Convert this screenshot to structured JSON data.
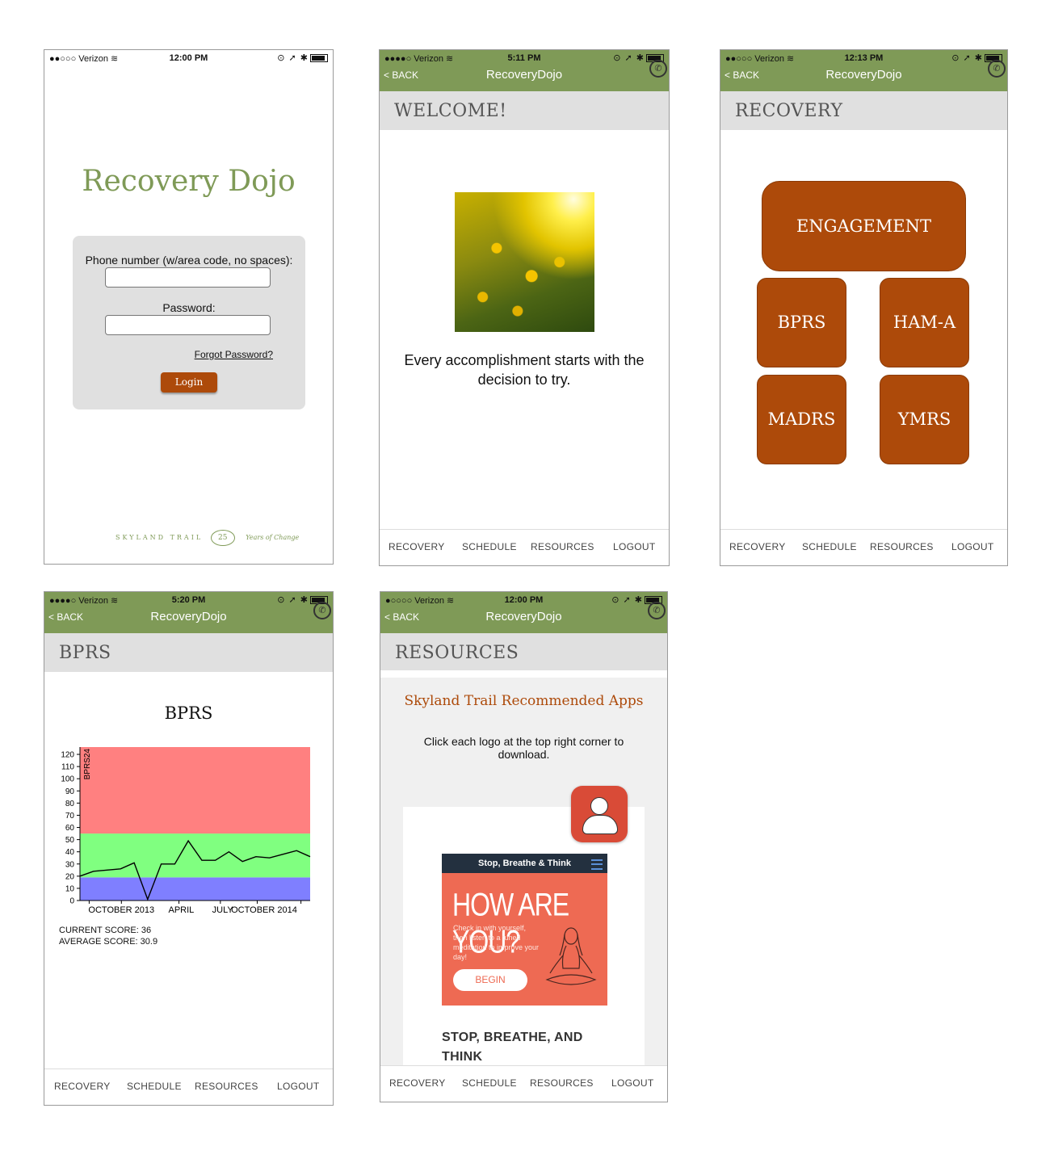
{
  "status": {
    "carrier": "Verizon",
    "times": [
      "12:00 PM",
      "5:11 PM",
      "12:13 PM",
      "5:20 PM",
      "12:00 PM"
    ]
  },
  "nav": {
    "back_label": "< BACK",
    "app_title": "RecoveryDojo"
  },
  "tabs": [
    "RECOVERY",
    "SCHEDULE",
    "RESOURCES",
    "LOGOUT"
  ],
  "login": {
    "title": "Recovery Dojo",
    "phone_label": "Phone number (w/area code, no spaces):",
    "password_label": "Password:",
    "forgot_label": "Forgot Password?",
    "login_label": "Login",
    "footer_brand": "SKYLAND TRAIL",
    "footer_tagline": "Years of Change",
    "footer_mark": "25"
  },
  "welcome": {
    "page_title": "WELCOME!",
    "quote": "Every accomplishment starts with the decision to try."
  },
  "recovery": {
    "page_title": "RECOVERY",
    "tiles": [
      "ENGAGEMENT",
      "BPRS",
      "HAM-A",
      "MADRS",
      "YMRS"
    ]
  },
  "bprs": {
    "page_title": "BPRS",
    "chart_title": "BPRS",
    "current_score": "CURRENT SCORE: 36",
    "average_score": "AVERAGE SCORE: 30.9"
  },
  "chart_data": {
    "type": "line",
    "title": "BPRS",
    "ylabel": "BPRS24",
    "xlabel": "",
    "ylim": [
      0,
      126
    ],
    "yticks": [
      0,
      10,
      20,
      30,
      40,
      50,
      60,
      70,
      80,
      90,
      100,
      110,
      120
    ],
    "xtick_labels": [
      "OCTOBER 2013",
      "APRIL",
      "JULY",
      "OCTOBER 2014"
    ],
    "bands": [
      {
        "from": 0,
        "to": 19,
        "color": "#7f7fff"
      },
      {
        "from": 19,
        "to": 55,
        "color": "#80ff80"
      },
      {
        "from": 55,
        "to": 126,
        "color": "#ff8080"
      }
    ],
    "series": [
      {
        "values": [
          20,
          24,
          25,
          26,
          31,
          1,
          30,
          30,
          49,
          33,
          33,
          40,
          32,
          36,
          35,
          38,
          41,
          36
        ]
      }
    ]
  },
  "resources": {
    "page_title": "RESOURCES",
    "section_title": "Skyland Trail Recommended Apps",
    "description": "Click each logo at the top right corner to download.",
    "app_bar_title": "Stop, Breathe & Think",
    "app_headline": "HOW ARE YOU?",
    "app_subtext": "Check in with yourself, then listen to a tuned meditation to improve your day!",
    "app_begin": "BEGIN",
    "app_name": "STOP, BREATHE, AND THINK"
  }
}
